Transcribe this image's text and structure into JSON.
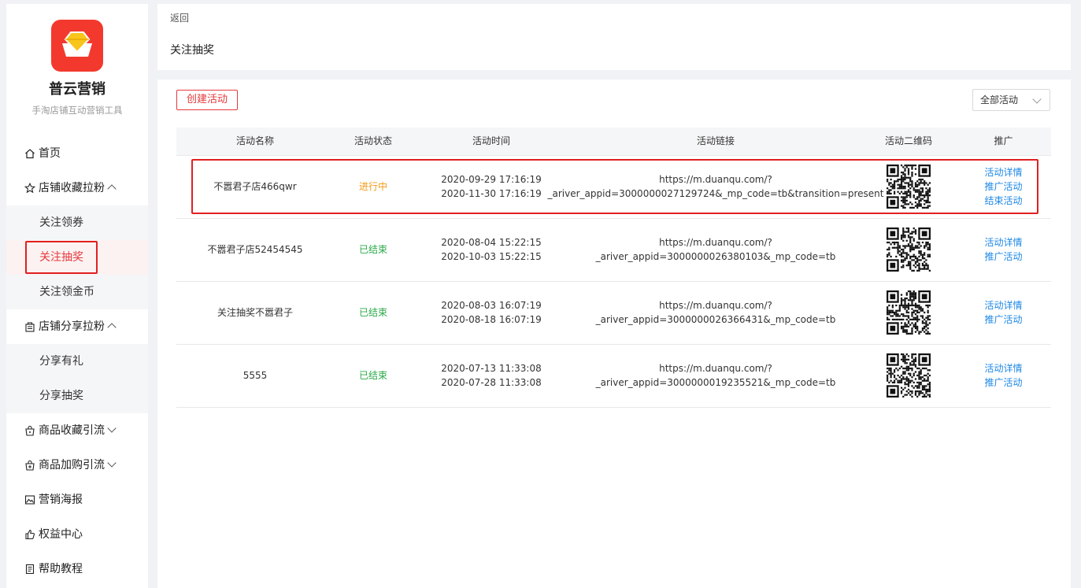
{
  "sidebar": {
    "brand_name": "普云营销",
    "brand_subtitle": "手淘店铺互动营销工具",
    "brand_color": "#f3392e",
    "nav": [
      {
        "label": "首页",
        "icon": "home-icon"
      },
      {
        "label": "店铺收藏拉粉",
        "icon": "star-icon",
        "expanded": true,
        "children": [
          "关注领券",
          "关注抽奖",
          "关注领金币"
        ]
      },
      {
        "label": "店铺分享拉粉",
        "icon": "share-icon",
        "expanded": true,
        "children": [
          "分享有礼",
          "分享抽奖"
        ]
      },
      {
        "label": "商品收藏引流",
        "icon": "bag-icon",
        "expanded": false
      },
      {
        "label": "商品加购引流",
        "icon": "cart-bag-icon",
        "expanded": false
      },
      {
        "label": "营销海报",
        "icon": "image-icon"
      },
      {
        "label": "权益中心",
        "icon": "thumb-up-icon"
      },
      {
        "label": "帮助教程",
        "icon": "doc-icon"
      }
    ],
    "active_item": "关注抽奖"
  },
  "header": {
    "back_label": "返回",
    "title": "关注抽奖"
  },
  "toolbar": {
    "create_label": "创建活动",
    "filter_value": "全部活动"
  },
  "table": {
    "columns": [
      "活动名称",
      "活动状态",
      "活动时间",
      "活动链接",
      "活动二维码",
      "推广"
    ],
    "rows": [
      {
        "name": "不嚣君子店466qwr",
        "status": "进行中",
        "start": "2020-09-29 17:16:19",
        "end": "2020-11-30 17:16:19",
        "link_line1": "https://m.duanqu.com/?",
        "link_line2": "_ariver_appid=3000000027129724&_mp_code=tb&transition=present",
        "actions": [
          "活动详情",
          "推广活动",
          "结束活动"
        ]
      },
      {
        "name": "不嚣君子店52454545",
        "status": "已结束",
        "start": "2020-08-04 15:22:15",
        "end": "2020-10-03 15:22:15",
        "link_line1": "https://m.duanqu.com/?",
        "link_line2": "_ariver_appid=3000000026380103&_mp_code=tb",
        "actions": [
          "活动详情",
          "推广活动"
        ]
      },
      {
        "name": "关注抽奖不嚣君子",
        "status": "已结束",
        "start": "2020-08-03 16:07:19",
        "end": "2020-08-18 16:07:19",
        "link_line1": "https://m.duanqu.com/?",
        "link_line2": "_ariver_appid=3000000026366431&_mp_code=tb",
        "actions": [
          "活动详情",
          "推广活动"
        ]
      },
      {
        "name": "5555",
        "status": "已结束",
        "start": "2020-07-13 11:33:08",
        "end": "2020-07-28 11:33:08",
        "link_line1": "https://m.duanqu.com/?",
        "link_line2": "_ariver_appid=3000000019235521&_mp_code=tb",
        "actions": [
          "活动详情",
          "推广活动"
        ]
      }
    ]
  },
  "colors": {
    "accent": "#e4393c",
    "running": "#f39a16",
    "ended": "#29a847",
    "link": "#1e88e5",
    "highlight_box": "#e02020"
  }
}
